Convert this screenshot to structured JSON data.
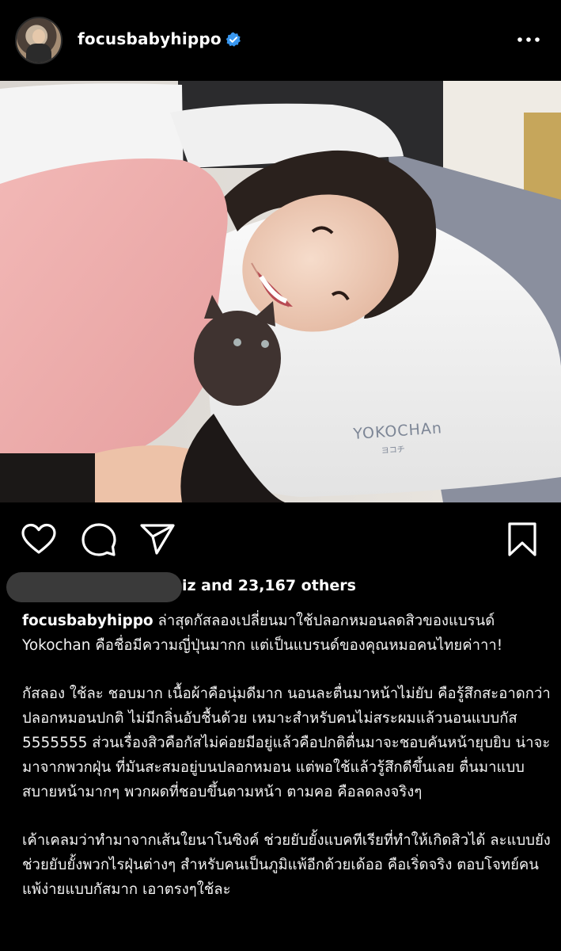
{
  "post": {
    "username": "focusbabyhippo",
    "verified": true,
    "more_icon": "more-horizontal-icon"
  },
  "photo": {
    "pillow_brand": "YOKOCHAn",
    "pillow_brand_jp": "ヨコチ"
  },
  "actions": {
    "like_icon": "heart-icon",
    "comment_icon": "comment-icon",
    "share_icon": "send-icon",
    "save_icon": "bookmark-icon"
  },
  "likes": {
    "text": "iz and 23,167 others"
  },
  "caption": {
    "username": "focusbabyhippo",
    "p1": " ล่าสุดกัสลองเปลี่ยนมาใช้ปลอกหมอนลดสิวของแบรนด์ Yokochan คือชื่อมีความญี่ปุ่นมากก แต่เป็นแบรนด์ของคุณหมอคนไทยค่าาา!",
    "p2": "กัสลอง ใช้ละ ชอบมาก เนื้อผ้าคือนุ่มดีมาก นอนละตื่นมาหน้าไม่ยับ คือรู้สึกสะอาดกว่าปลอกหมอนปกติ ไม่มีกลิ่นอับชื้นด้วย เหมาะสำหรับคนไม่สระผมแล้วนอนแบบกัส 5555555 ส่วนเรื่องสิวคือกัสไม่ค่อยมีอยู่แล้วคือปกติตื่นมาจะชอบคันหน้ายุบยิบ น่าจะมาจากพวกฝุ่น ที่มันสะสมอยู่บนปลอกหมอน แต่พอใช้แล้วรู้สึกดีขึ้นเลย ตื่นมาแบบสบายหน้ามากๆ พวกผดที่ชอบขึ้นตามหน้า ตามคอ คือลดลงจริงๆ",
    "p3": "เค้าเคลมว่าทำมาจากเส้นใยนาโนซิงค์ ช่วยยับยั้งแบคทีเรียที่ทำให้เกิดสิวได้ ละแบบยังช่วยยับยั้งพวกไรฝุ่นต่างๆ สำหรับคนเป็นภูมิแพ้อีกด้วยเด้ออ คือเริ่ดจริง ตอบโจทย์คนแพ้ง่ายแบบกัสมาก เอาตรงๆใช้ละ"
  }
}
